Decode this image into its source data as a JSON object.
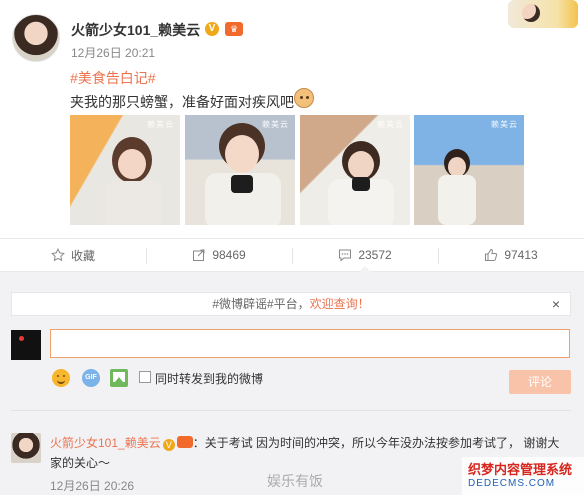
{
  "post": {
    "author": "火箭少女101_赖美云",
    "verified_glyph": "V",
    "time": "12月26日 20:21",
    "hashtag": "#美食告白记#",
    "text": "夹我的那只螃蟹，准备好面对疾风吧",
    "photo_watermark": "赖美云",
    "photos": 4
  },
  "actions": [
    {
      "label": "收藏",
      "icon": "star-icon"
    },
    {
      "label": "98469",
      "icon": "share-icon"
    },
    {
      "label": "23572",
      "icon": "comment-icon"
    },
    {
      "label": "97413",
      "icon": "thumb-up-icon"
    }
  ],
  "comment_box": {
    "notice_prefix": "#微博辟谣#平台，",
    "notice_link": "欢迎查询！",
    "close": "×",
    "input_value": "",
    "repost_label": "同时转发到我的微博",
    "submit_label": "评论",
    "gif_label": "GIF"
  },
  "comments": [
    {
      "author": "火箭少女101_赖美云",
      "badge_glyph": "V",
      "text": "：关于考试 因为时间的冲突，所以今年没办法按参加考试了， 谢谢大家的关心～",
      "time": "12月26日 20:26"
    }
  ],
  "overlay": {
    "watermark_text": "娱乐有饭",
    "logo_line1": "织梦内容管理系统",
    "logo_line2": "DEDECMS.COM"
  },
  "colors": {
    "accent": "#eb7350",
    "verified": "#f0a81b",
    "submit_disabled": "#f9c3a9",
    "comment_bg": "#f2f2f5"
  }
}
